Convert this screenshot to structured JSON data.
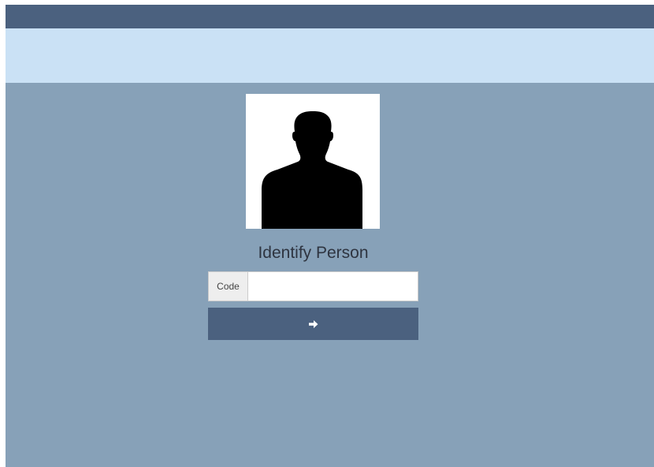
{
  "form": {
    "title": "Identify Person",
    "code_label": "Code",
    "code_value": "",
    "code_placeholder": "",
    "submit_icon": "arrow-right-icon"
  },
  "colors": {
    "topbar": "#4b617f",
    "subbar": "#cae1f5",
    "background": "#87a1b8",
    "button": "#4b617f"
  }
}
